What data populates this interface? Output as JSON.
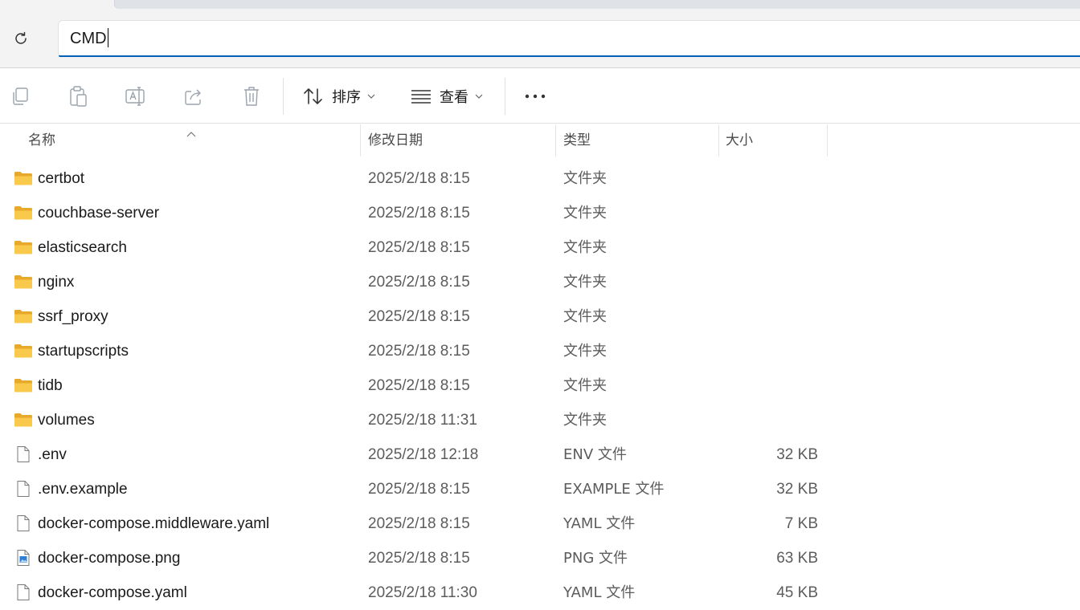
{
  "address": {
    "value": "CMD"
  },
  "toolbar": {
    "sort_label": "排序",
    "view_label": "查看",
    "more_label": "···"
  },
  "columns": {
    "name": "名称",
    "modified": "修改日期",
    "type": "类型",
    "size": "大小"
  },
  "files": [
    {
      "name": "certbot",
      "modified": "2025/2/18 8:15",
      "type": "文件夹",
      "size": "",
      "icon": "folder-icon"
    },
    {
      "name": "couchbase-server",
      "modified": "2025/2/18 8:15",
      "type": "文件夹",
      "size": "",
      "icon": "folder-icon"
    },
    {
      "name": "elasticsearch",
      "modified": "2025/2/18 8:15",
      "type": "文件夹",
      "size": "",
      "icon": "folder-icon"
    },
    {
      "name": "nginx",
      "modified": "2025/2/18 8:15",
      "type": "文件夹",
      "size": "",
      "icon": "folder-icon"
    },
    {
      "name": "ssrf_proxy",
      "modified": "2025/2/18 8:15",
      "type": "文件夹",
      "size": "",
      "icon": "folder-icon"
    },
    {
      "name": "startupscripts",
      "modified": "2025/2/18 8:15",
      "type": "文件夹",
      "size": "",
      "icon": "folder-icon"
    },
    {
      "name": "tidb",
      "modified": "2025/2/18 8:15",
      "type": "文件夹",
      "size": "",
      "icon": "folder-icon"
    },
    {
      "name": "volumes",
      "modified": "2025/2/18 11:31",
      "type": "文件夹",
      "size": "",
      "icon": "folder-icon"
    },
    {
      "name": ".env",
      "modified": "2025/2/18 12:18",
      "type": "ENV 文件",
      "size": "32 KB",
      "icon": "file-icon"
    },
    {
      "name": ".env.example",
      "modified": "2025/2/18 8:15",
      "type": "EXAMPLE 文件",
      "size": "32 KB",
      "icon": "file-icon"
    },
    {
      "name": "docker-compose.middleware.yaml",
      "modified": "2025/2/18 8:15",
      "type": "YAML 文件",
      "size": "7 KB",
      "icon": "file-icon"
    },
    {
      "name": "docker-compose.png",
      "modified": "2025/2/18 8:15",
      "type": "PNG 文件",
      "size": "63 KB",
      "icon": "image-file-icon"
    },
    {
      "name": "docker-compose.yaml",
      "modified": "2025/2/18 11:30",
      "type": "YAML 文件",
      "size": "45 KB",
      "icon": "file-icon"
    }
  ],
  "colors": {
    "accent": "#005fb8",
    "folder": "#f8c94a",
    "folder_dark": "#e8a92a",
    "text_secondary": "#5c5c5c"
  }
}
